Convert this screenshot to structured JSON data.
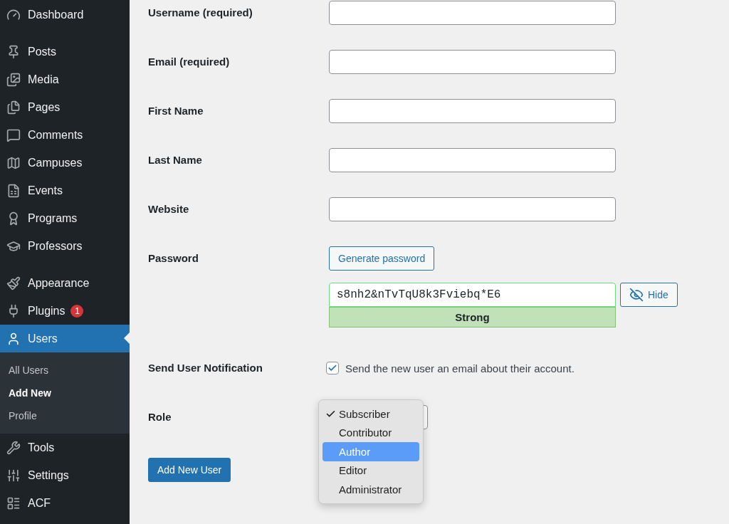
{
  "sidebar": {
    "groups": [
      {
        "items": [
          {
            "label": "Dashboard",
            "selected": false
          }
        ]
      },
      {
        "items": [
          {
            "label": "Posts",
            "selected": false
          },
          {
            "label": "Media",
            "selected": false
          },
          {
            "label": "Pages",
            "selected": false
          },
          {
            "label": "Comments",
            "selected": false
          },
          {
            "label": "Campuses",
            "selected": false
          },
          {
            "label": "Events",
            "selected": false
          },
          {
            "label": "Programs",
            "selected": false
          },
          {
            "label": "Professors",
            "selected": false
          }
        ]
      },
      {
        "items": [
          {
            "label": "Appearance",
            "selected": false
          },
          {
            "label": "Plugins",
            "selected": false,
            "badge": "1"
          },
          {
            "label": "Users",
            "selected": true,
            "submenu": [
              {
                "label": "All Users",
                "selected": false
              },
              {
                "label": "Add New",
                "selected": true
              },
              {
                "label": "Profile",
                "selected": false
              }
            ]
          },
          {
            "label": "Tools",
            "selected": false
          },
          {
            "label": "Settings",
            "selected": false
          },
          {
            "label": "ACF",
            "selected": false
          }
        ]
      }
    ]
  },
  "form": {
    "fields": [
      {
        "kind": "text",
        "label": "Username (required)"
      },
      {
        "kind": "text",
        "label": "Email (required)"
      },
      {
        "kind": "text",
        "label": "First Name"
      },
      {
        "kind": "text",
        "label": "Last Name"
      },
      {
        "kind": "text",
        "label": "Website"
      },
      {
        "kind": "password",
        "label": "Password",
        "generate_button": "Generate password",
        "value": "s8nh2&nTvTqU8k3Fviebq*E6",
        "strength": "Strong",
        "hide_button": "Hide"
      },
      {
        "kind": "checkbox",
        "label": "Send User Notification",
        "checked": true,
        "text": "Send the new user an email about their account."
      },
      {
        "kind": "select",
        "label": "Role",
        "options": [
          {
            "label": "Subscriber",
            "checked": true,
            "selected": false
          },
          {
            "label": "Contributor",
            "checked": false,
            "selected": false
          },
          {
            "label": "Author",
            "checked": false,
            "selected": true
          },
          {
            "label": "Editor",
            "checked": false,
            "selected": false
          },
          {
            "label": "Administrator",
            "checked": false,
            "selected": false
          }
        ]
      }
    ],
    "submit": "Add New User"
  }
}
